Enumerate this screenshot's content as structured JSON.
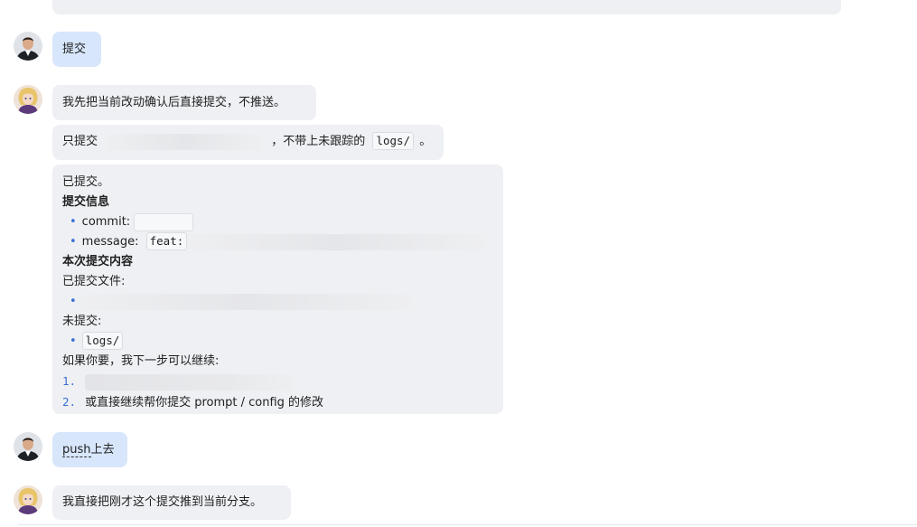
{
  "messages": {
    "user1": {
      "text": "提交"
    },
    "bot1": {
      "line1": "我先把当前改动确认后直接提交，不推送。",
      "line2_prefix": "只提交",
      "line2_middle": "，不带上未跟踪的",
      "line2_code": "logs/",
      "line2_suffix": "。"
    },
    "bot2": {
      "committed": "已提交。",
      "info_heading": "提交信息",
      "commit_label": "commit:",
      "message_label": "message:",
      "message_code": "feat:",
      "content_heading": "本次提交内容",
      "files_label": "已提交文件:",
      "uncommitted_label": "未提交:",
      "uncommitted_code": "logs/",
      "next_intro": "如果你要，我下一步可以继续:",
      "step1_num": "1.",
      "step2_num": "2.",
      "step2_text": "或直接继续帮你提交 prompt / config 的修改"
    },
    "user2": {
      "text_dashed": "push",
      "text_rest": "上去"
    },
    "bot3": {
      "text": "我直接把刚才这个提交推到当前分支。"
    }
  },
  "icons": {
    "bullet": "•"
  },
  "colors": {
    "user_bubble": "#d7e6fb",
    "bot_bubble": "#eef0f3",
    "accent": "#3b6fd8"
  }
}
